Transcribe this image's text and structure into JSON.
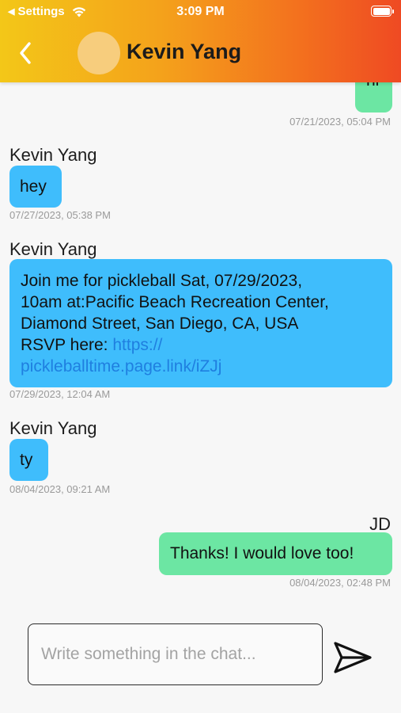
{
  "status_bar": {
    "back_app": "Settings",
    "time": "3:09 PM"
  },
  "header": {
    "title": "Kevin Yang"
  },
  "messages": [
    {
      "text": "hi",
      "timestamp": "07/21/2023, 05:04 PM"
    },
    {
      "sender": "Kevin Yang",
      "text": "hey",
      "timestamp": "07/27/2023, 05:38 PM"
    },
    {
      "sender": "Kevin Yang",
      "line1": "Join me for pickleball Sat, 07/29/2023,",
      "line2": "10am at:Pacific Beach Recreation Center,",
      "line3": "Diamond Street, San Diego, CA, USA",
      "line4_prefix": "RSVP here: ",
      "link_part1": "https://",
      "link_part2": "pickleballtime.page.link/iZJj",
      "timestamp": "07/29/2023, 12:04 AM"
    },
    {
      "sender": "Kevin Yang",
      "text": "ty",
      "timestamp": "08/04/2023, 09:21 AM"
    },
    {
      "sender": "JD",
      "text": "Thanks! I would love too!",
      "timestamp": "08/04/2023, 02:48 PM"
    }
  ],
  "composer": {
    "placeholder": "Write something in the chat..."
  },
  "colors": {
    "incoming_bubble": "#3fbdfc",
    "outgoing_bubble": "#6ce6a3",
    "link": "#1f7fe0"
  }
}
